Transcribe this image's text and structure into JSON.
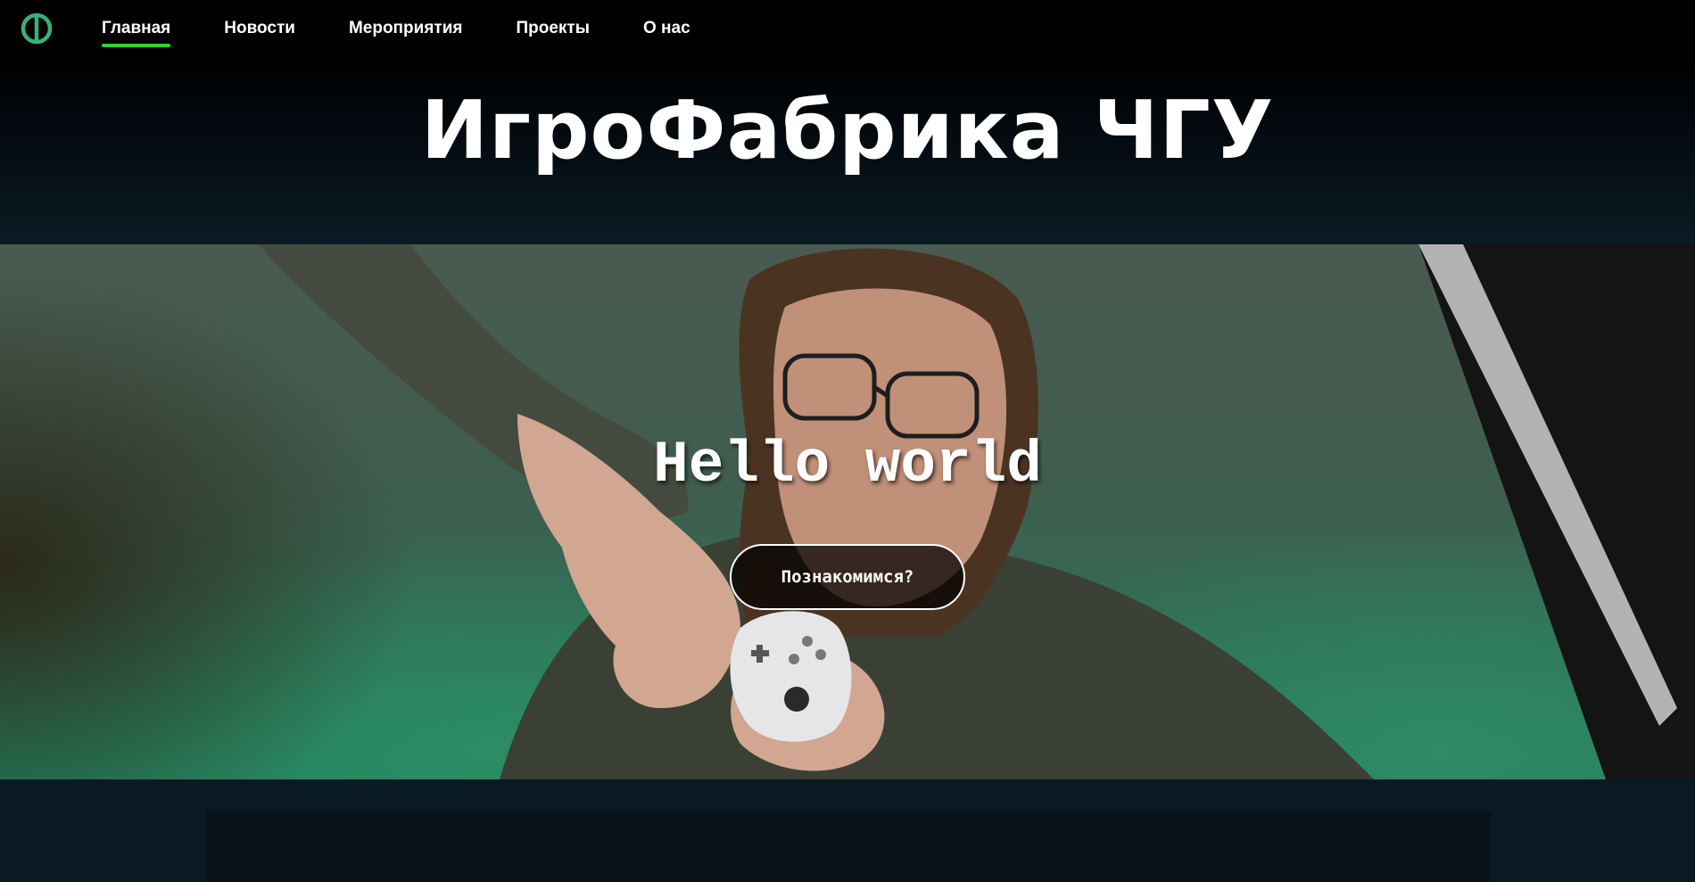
{
  "nav": {
    "logo_icon": "phi-logo-icon",
    "accent_color": "#36d12b",
    "logo_color": "#3ab07a",
    "items": [
      {
        "label": "Главная",
        "active": true
      },
      {
        "label": "Новости",
        "active": false
      },
      {
        "label": "Мероприятия",
        "active": false
      },
      {
        "label": "Проекты",
        "active": false
      },
      {
        "label": "О нас",
        "active": false
      }
    ]
  },
  "header": {
    "title": "ИгроФабрика ЧГУ"
  },
  "hero": {
    "heading": "Hello world",
    "button_label": "Познакомимся?"
  }
}
